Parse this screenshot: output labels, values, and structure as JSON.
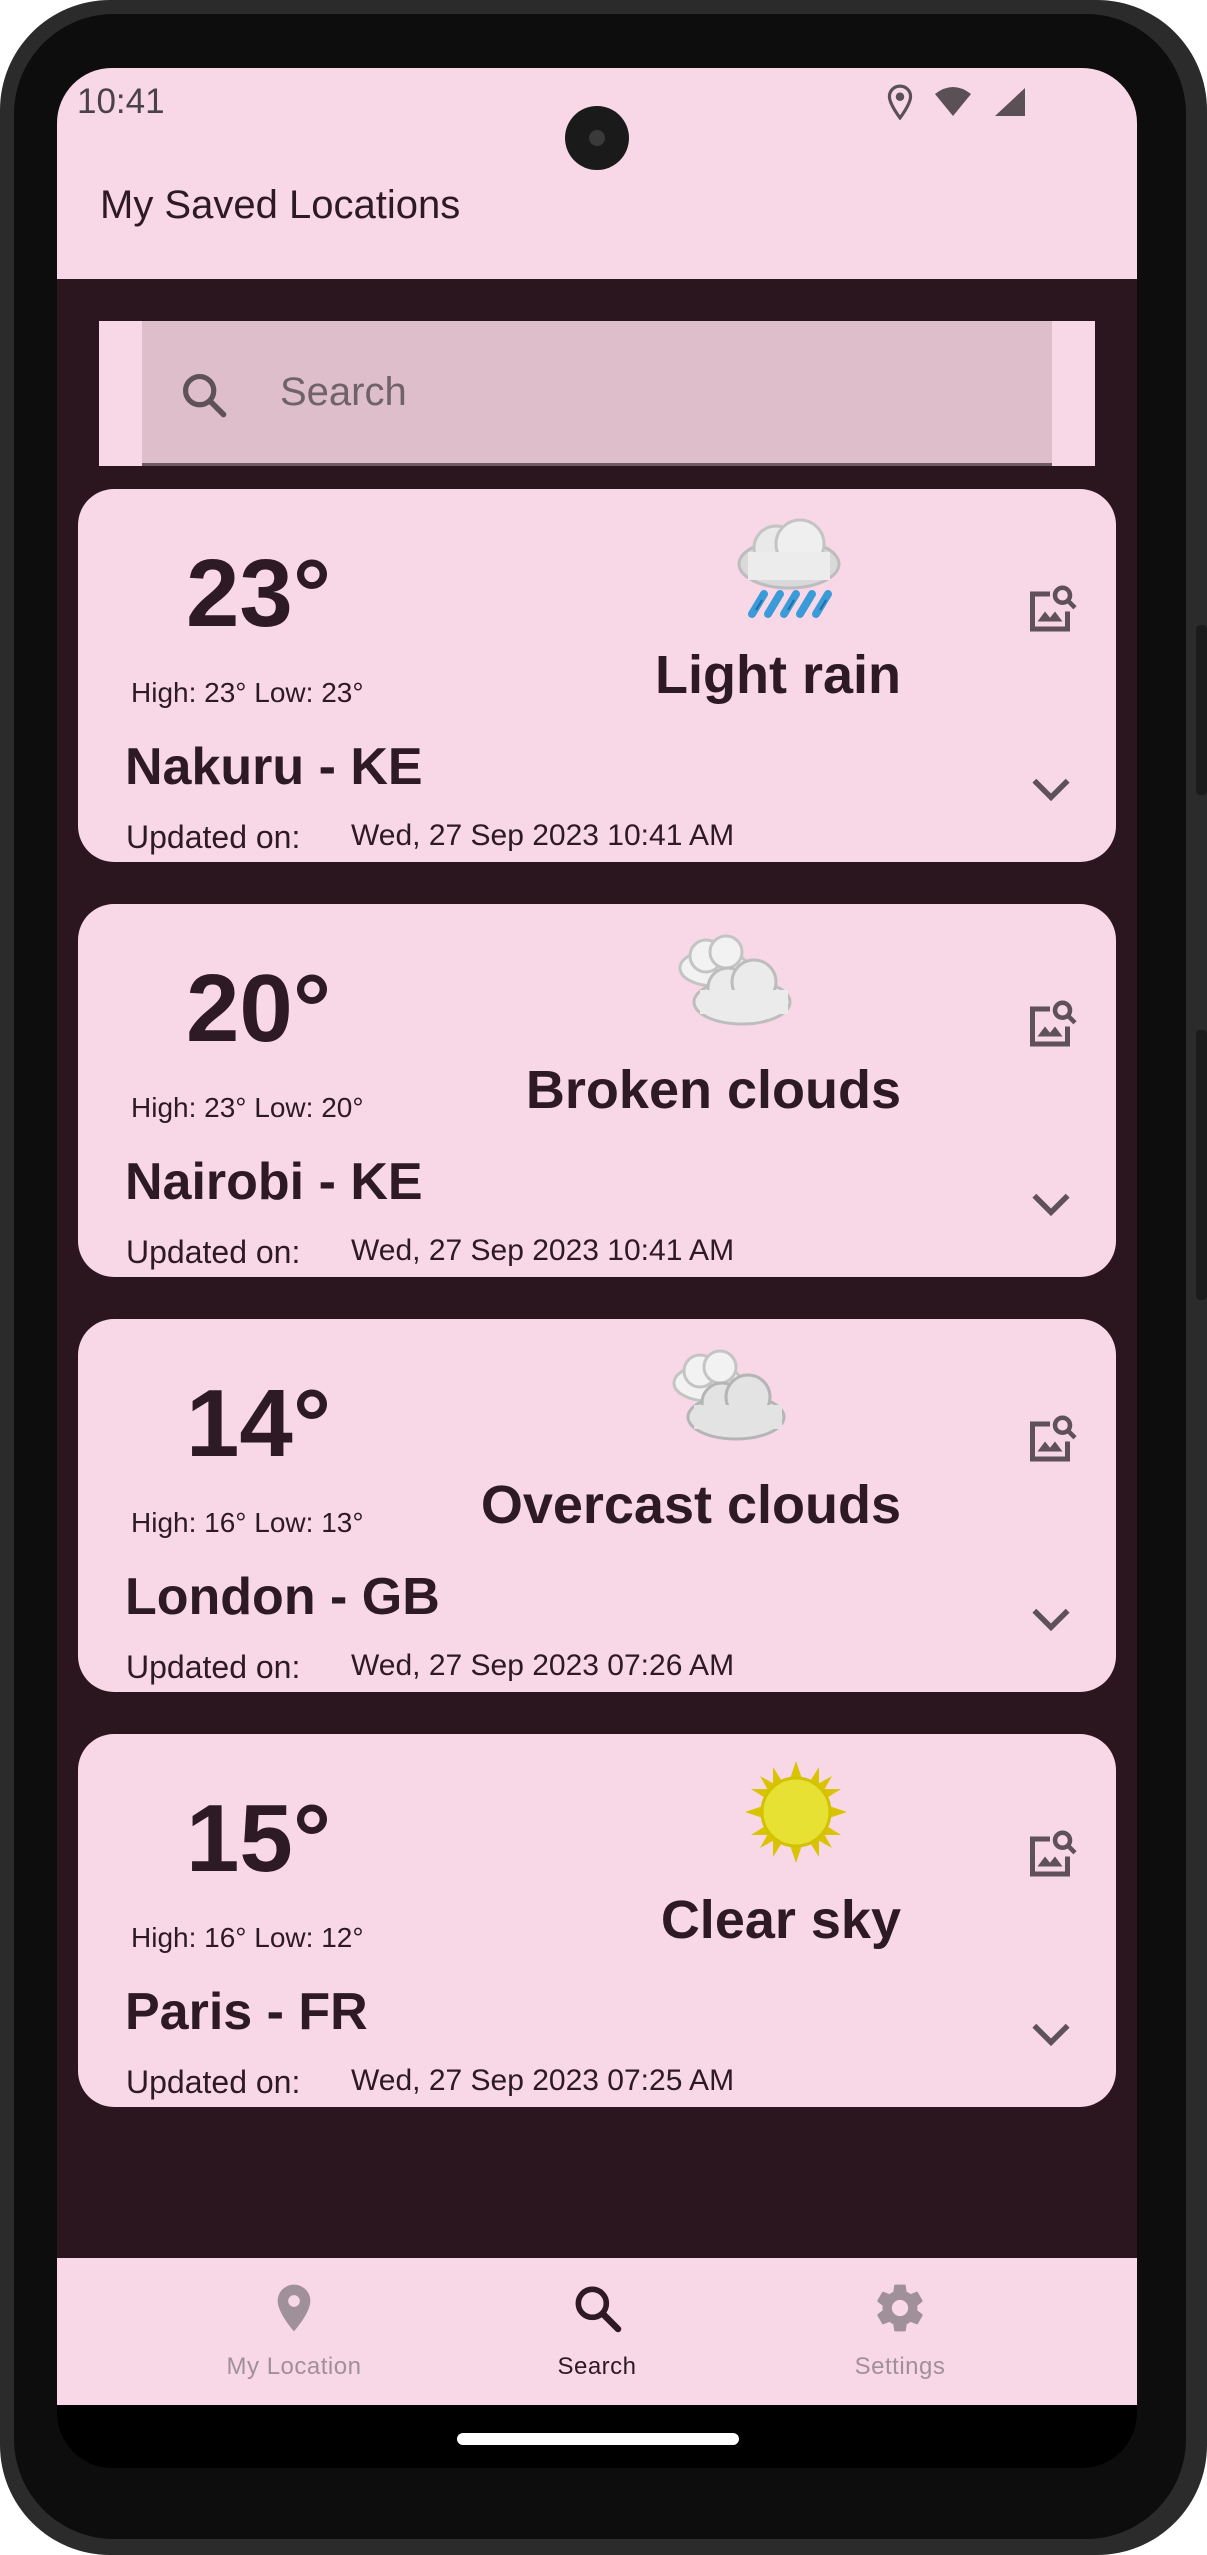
{
  "status_bar": {
    "time": "10:41"
  },
  "app_bar": {
    "title": "My Saved Locations"
  },
  "search": {
    "placeholder": "Search"
  },
  "colors": {
    "surface": "#f8d7e6",
    "background": "#2b1620",
    "text": "#2d1a24",
    "search_field": "#debecb",
    "sun": "#e6e133",
    "rain": "#3a9bd8"
  },
  "locations": [
    {
      "temperature": "23°",
      "high_low": "High: 23° Low: 23°",
      "city": "Nakuru - KE",
      "condition": "Light rain",
      "icon": "light-rain-icon",
      "updated_label": "Updated on:",
      "updated_value": "Wed, 27 Sep 2023 10:41 AM"
    },
    {
      "temperature": "20°",
      "high_low": "High: 23° Low: 20°",
      "city": "Nairobi - KE",
      "condition": "Broken clouds",
      "icon": "broken-clouds-icon",
      "updated_label": "Updated on:",
      "updated_value": "Wed, 27 Sep 2023 10:41 AM"
    },
    {
      "temperature": "14°",
      "high_low": "High: 16° Low: 13°",
      "city": "London - GB",
      "condition": "Overcast clouds",
      "icon": "overcast-clouds-icon",
      "updated_label": "Updated on:",
      "updated_value": "Wed, 27 Sep 2023 07:26 AM"
    },
    {
      "temperature": "15°",
      "high_low": "High: 16° Low: 12°",
      "city": "Paris - FR",
      "condition": "Clear sky",
      "icon": "clear-sky-icon",
      "updated_label": "Updated on:",
      "updated_value": "Wed, 27 Sep 2023 07:25 AM"
    }
  ],
  "bottom_nav": {
    "items": [
      {
        "label": "My Location",
        "icon": "location-pin-icon",
        "active": false
      },
      {
        "label": "Search",
        "icon": "search-icon",
        "active": true
      },
      {
        "label": "Settings",
        "icon": "gear-icon",
        "active": false
      }
    ]
  }
}
